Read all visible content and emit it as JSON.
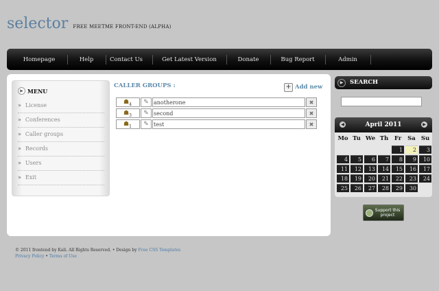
{
  "logo": {
    "name": "selector",
    "tagline": "FREE MEETME FRONT-END (ALPHA)"
  },
  "nav": {
    "items": [
      "Homepage",
      "Help",
      "Contact Us",
      "Get Latest Version",
      "Donate",
      "Bug Report",
      "Admin"
    ]
  },
  "menu": {
    "title": "MENU",
    "items": [
      "License",
      "Conferences",
      "Caller groups",
      "Records",
      "Users",
      "Exit"
    ]
  },
  "groups": {
    "title": "CALLER GROUPS :",
    "add_label": "Add new",
    "rows": [
      {
        "count": "4",
        "name": "anotherone"
      },
      {
        "count": "3",
        "name": "second"
      },
      {
        "count": "1",
        "name": "test"
      }
    ]
  },
  "search": {
    "title": "SEARCH",
    "value": ""
  },
  "calendar": {
    "month": "April 2011",
    "days_of_week": [
      "Mo",
      "Tu",
      "We",
      "Th",
      "Fr",
      "Sa",
      "Su"
    ],
    "first_weekday_index": 4,
    "days_in_month": 30,
    "today": 2
  },
  "support": {
    "label": "Support this project"
  },
  "footer": {
    "copyright": "© 2011 frontend by Kali. All Rights Reserved. • Design by",
    "design_link": "Free CSS Templates",
    "privacy": "Privacy Policy",
    "bullet": "•",
    "terms": "Terms of Use"
  },
  "colors": {
    "link_blue": "#5c8aaa",
    "nav_dark": "#101010",
    "today_highlight": "#f4f2b8"
  }
}
